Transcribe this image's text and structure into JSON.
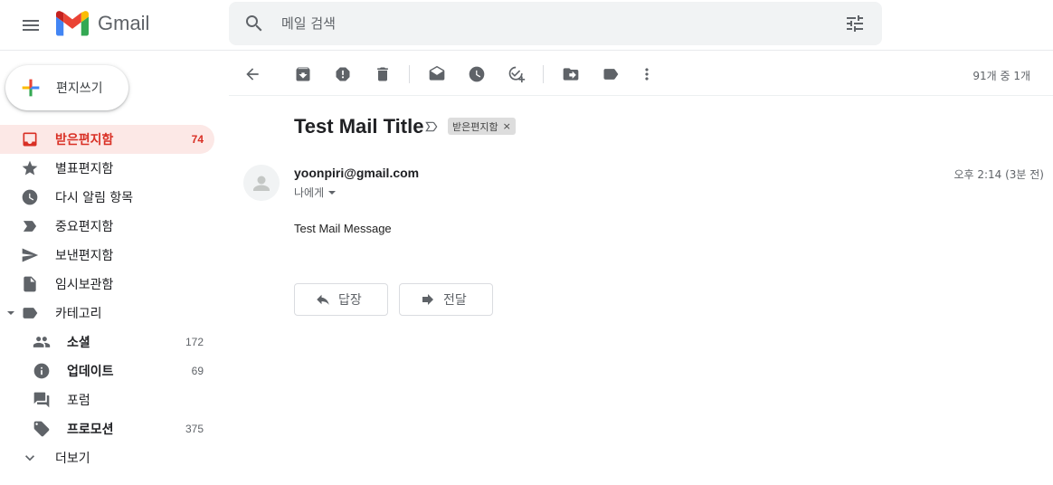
{
  "header": {
    "app_name": "Gmail",
    "search_placeholder": "메일 검색"
  },
  "compose": {
    "label": "편지쓰기"
  },
  "sidebar": {
    "items": [
      {
        "label": "받은편지함",
        "count": "74",
        "icon": "inbox-icon",
        "active": true
      },
      {
        "label": "별표편지함",
        "count": "",
        "icon": "star-icon"
      },
      {
        "label": "다시 알림 항목",
        "count": "",
        "icon": "clock-icon"
      },
      {
        "label": "중요편지함",
        "count": "",
        "icon": "important-label-icon"
      },
      {
        "label": "보낸편지함",
        "count": "",
        "icon": "send-icon"
      },
      {
        "label": "임시보관함",
        "count": "",
        "icon": "draft-icon"
      },
      {
        "label": "카테고리",
        "count": "",
        "icon": "label-icon"
      }
    ],
    "categories": [
      {
        "label": "소셜",
        "count": "172",
        "icon": "people-icon",
        "bold": true
      },
      {
        "label": "업데이트",
        "count": "69",
        "icon": "info-icon",
        "bold": true
      },
      {
        "label": "포럼",
        "count": "",
        "icon": "forum-icon",
        "bold": false
      },
      {
        "label": "프로모션",
        "count": "375",
        "icon": "tag-icon",
        "bold": true
      }
    ],
    "more": {
      "label": "더보기",
      "icon": "chevron-down-icon"
    }
  },
  "toolbar": {
    "page_count": "91개 중 1개"
  },
  "message": {
    "subject": "Test Mail Title",
    "label_chip": "받은편지함",
    "label_chip_close": "×",
    "sender": "yoonpiri@gmail.com",
    "recipient": "나에게",
    "time": "오후 2:14 (3분 전)",
    "body": "Test Mail Message",
    "reply_label": "답장",
    "forward_label": "전달"
  },
  "colors": {
    "accent_red": "#d93025",
    "active_bg": "#fce8e6",
    "search_bg": "#f1f3f4",
    "icon_grey": "#5f6368"
  }
}
